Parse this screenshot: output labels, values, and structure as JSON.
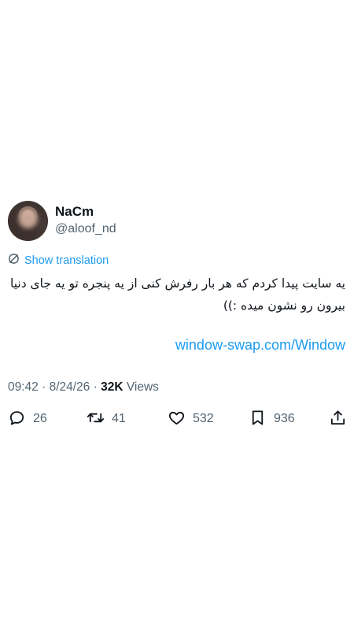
{
  "author": {
    "display_name": "NaCm",
    "handle": "@aloof_nd"
  },
  "translate": {
    "label": "Show translation",
    "icon": "translate-icon"
  },
  "tweet": {
    "text": "یه سایت پیدا کردم که هر بار رفرش کنی از یه پنجره تو یه جای دنیا بیرون رو نشون میده :))",
    "link": "window-swap.com/Window"
  },
  "meta": {
    "time": "09:42",
    "separator": " · ",
    "date": "8/24/26",
    "views_count": "32K",
    "views_label": " Views"
  },
  "actions": {
    "reply": {
      "icon": "reply-icon",
      "count": "26"
    },
    "retweet": {
      "icon": "retweet-icon",
      "count": "41"
    },
    "like": {
      "icon": "heart-icon",
      "count": "532"
    },
    "bookmark": {
      "icon": "bookmark-icon",
      "count": "936"
    },
    "share": {
      "icon": "share-icon"
    }
  },
  "colors": {
    "text": "#0f1419",
    "secondary": "#536471",
    "accent": "#1d9bf0",
    "background": "#ffffff"
  }
}
